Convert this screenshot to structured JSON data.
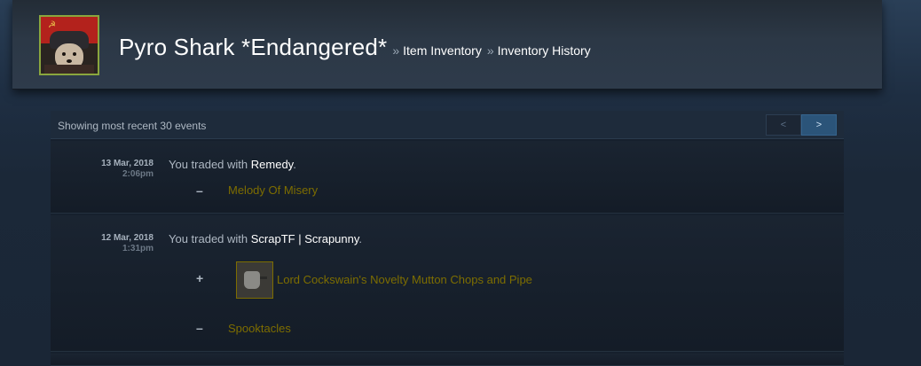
{
  "header": {
    "persona_name": "Pyro Shark *Endangered*",
    "crumbs": [
      {
        "sep": "»",
        "label": "Item Inventory"
      },
      {
        "sep": "»",
        "label": "Inventory History"
      }
    ]
  },
  "history": {
    "showing_text": "Showing most recent 30 events",
    "pager": {
      "prev": "<",
      "next": ">"
    }
  },
  "events": [
    {
      "date": "13 Mar, 2018",
      "time": "2:06pm",
      "prefix": "You traded with ",
      "partner": "Remedy",
      "suffix": ".",
      "items": [
        {
          "sign": "–",
          "name": "Melody Of Misery"
        }
      ]
    },
    {
      "date": "12 Mar, 2018",
      "time": "1:31pm",
      "prefix": "You traded with ",
      "partner": "ScrapTF | Scrapunny",
      "suffix": ".",
      "items": [
        {
          "sign": "+",
          "name": "Lord Cockswain's Novelty Mutton Chops and Pipe"
        },
        {
          "sign": "–",
          "name": "Spooktacles"
        }
      ]
    }
  ],
  "colors": {
    "background": "#1b2838",
    "item_quality_unique": "#7d6d00",
    "avatar_border_online": "#8aa63e",
    "pager_active": "#2b5479"
  },
  "icons": {
    "item_icon_event2": "mutton-chops-pipe-icon"
  }
}
